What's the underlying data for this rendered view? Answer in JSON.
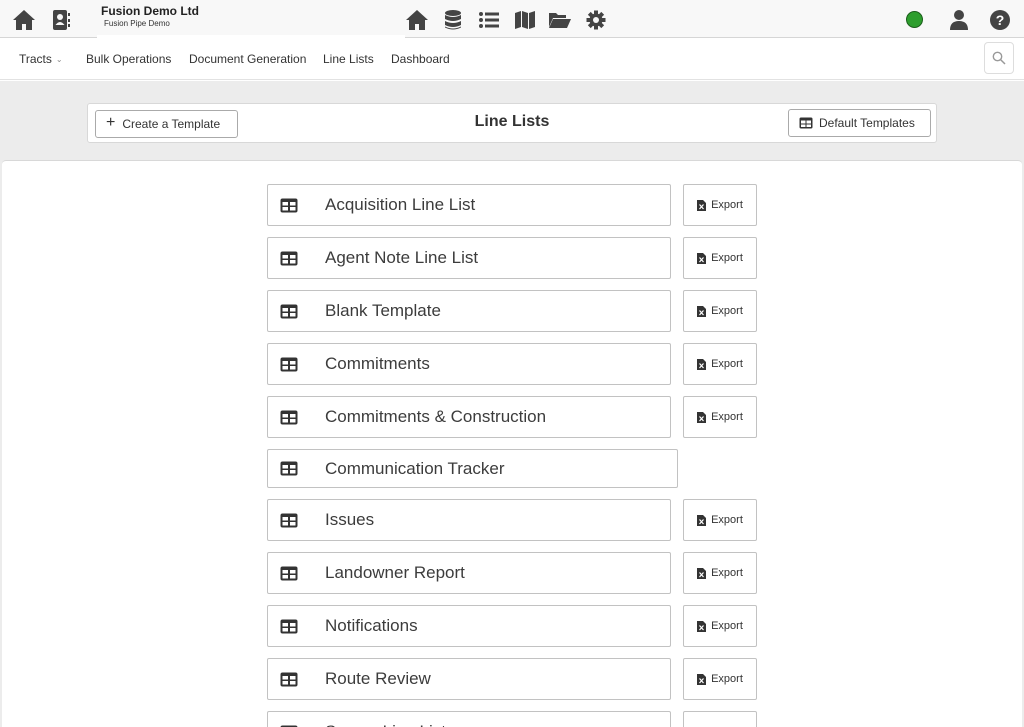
{
  "company": {
    "name": "Fusion Demo Ltd",
    "project": "Fusion Pipe Demo"
  },
  "icons": {
    "left": [
      "home-icon",
      "contacts-icon"
    ],
    "center": [
      "home-icon",
      "database-icon",
      "list-icon",
      "map-icon",
      "folder-open-icon",
      "gear-icon"
    ],
    "right": [
      "status-indicator",
      "user-icon",
      "help-icon"
    ]
  },
  "status_color": "#2e9e2e",
  "nav": {
    "items": [
      "Tracts",
      "Bulk Operations",
      "Document Generation",
      "Line Lists",
      "Dashboard"
    ]
  },
  "header": {
    "title": "Line Lists",
    "create_label": "Create a Template",
    "default_label": "Default Templates"
  },
  "export_label": "Export",
  "line_lists": [
    {
      "label": "Acquisition Line List",
      "export": true
    },
    {
      "label": "Agent Note Line List",
      "export": true
    },
    {
      "label": "Blank Template",
      "export": true
    },
    {
      "label": "Commitments",
      "export": true
    },
    {
      "label": "Commitments & Construction",
      "export": true
    },
    {
      "label": "Communication Tracker",
      "export": false
    },
    {
      "label": "Issues",
      "export": true
    },
    {
      "label": "Landowner Report",
      "export": true
    },
    {
      "label": "Notifications",
      "export": true
    },
    {
      "label": "Route Review",
      "export": true
    },
    {
      "label": "Survey Line List",
      "export": true
    }
  ]
}
